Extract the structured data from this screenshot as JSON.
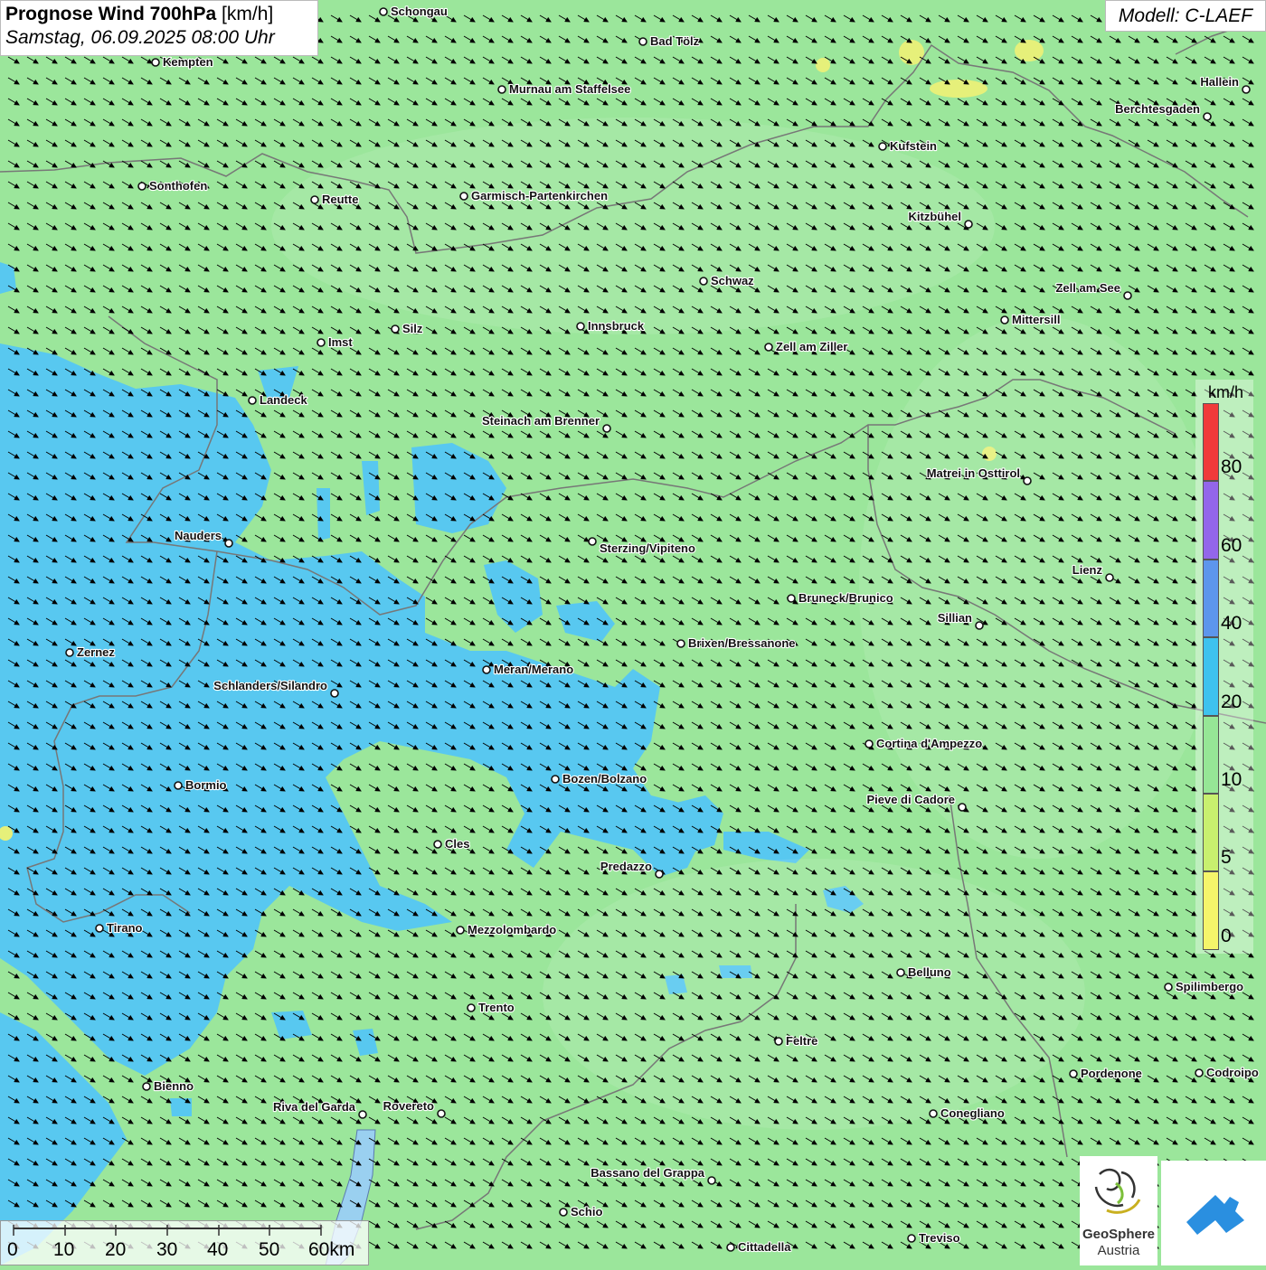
{
  "title": {
    "main": "Prognose Wind 700hPa",
    "unit": "[km/h]",
    "datetime": "Samstag, 06.09.2025 08:00 Uhr"
  },
  "model": "Modell: C-LAEF",
  "colors": {
    "background_10_20": "#9be69b",
    "field_20_40": "#58c8f0",
    "label_stroke": "#ffffff"
  },
  "legend": {
    "unit": "km/h",
    "bins": [
      {
        "from": 0,
        "to": 5,
        "color": "#f5f56a"
      },
      {
        "from": 5,
        "to": 10,
        "color": "#c8f06e"
      },
      {
        "from": 10,
        "to": 20,
        "color": "#96e696"
      },
      {
        "from": 20,
        "to": 40,
        "color": "#3ec2ee"
      },
      {
        "from": 40,
        "to": 60,
        "color": "#5d96ec"
      },
      {
        "from": 60,
        "to": 80,
        "color": "#9366ea"
      },
      {
        "from": 80,
        "to": 100,
        "color": "#f03a3a"
      }
    ],
    "labels": [
      "80",
      "60",
      "40",
      "20",
      "10",
      "5",
      "0"
    ]
  },
  "scalebar": {
    "labels": [
      "0",
      "10",
      "20",
      "30",
      "40",
      "50",
      "60km"
    ]
  },
  "wind": {
    "direction": "west-northwest flow (arrows pointing to east-southeast)"
  },
  "cities": [
    {
      "name": "Schongau"
    },
    {
      "name": "Bad Tölz"
    },
    {
      "name": "Kempten"
    },
    {
      "name": "Murnau am Staffelsee"
    },
    {
      "name": "Hallein"
    },
    {
      "name": "Berchtesgaden"
    },
    {
      "name": "Kufstein"
    },
    {
      "name": "Sonthofen"
    },
    {
      "name": "Reutte"
    },
    {
      "name": "Garmisch-Partenkirchen"
    },
    {
      "name": "Kitzbühel"
    },
    {
      "name": "Schwaz"
    },
    {
      "name": "Zell am See"
    },
    {
      "name": "Mittersill"
    },
    {
      "name": "Innsbruck"
    },
    {
      "name": "Silz"
    },
    {
      "name": "Imst"
    },
    {
      "name": "Zell am Ziller"
    },
    {
      "name": "Landeck"
    },
    {
      "name": "Steinach am Brenner"
    },
    {
      "name": "Matrei in Osttirol"
    },
    {
      "name": "Nauders"
    },
    {
      "name": "Sterzing/Vipiteno"
    },
    {
      "name": "Lienz"
    },
    {
      "name": "Bruneck/Brunico"
    },
    {
      "name": "Sillian"
    },
    {
      "name": "Brixen/Bressanone"
    },
    {
      "name": "Zernez"
    },
    {
      "name": "Meran/Merano"
    },
    {
      "name": "Schlanders/Silandro"
    },
    {
      "name": "Cortina d'Ampezzo"
    },
    {
      "name": "Bozen/Bolzano"
    },
    {
      "name": "Bormio"
    },
    {
      "name": "Pieve di Cadore"
    },
    {
      "name": "Cles"
    },
    {
      "name": "Predazzo"
    },
    {
      "name": "Tirano"
    },
    {
      "name": "Mezzolombardo"
    },
    {
      "name": "Belluno"
    },
    {
      "name": "Spilimbergo"
    },
    {
      "name": "Trento"
    },
    {
      "name": "Feltre"
    },
    {
      "name": "Pordenone"
    },
    {
      "name": "Codroipo"
    },
    {
      "name": "Bienno"
    },
    {
      "name": "Riva del Garda"
    },
    {
      "name": "Rovereto"
    },
    {
      "name": "Conegliano"
    },
    {
      "name": "Bassano del Grappa"
    },
    {
      "name": "Schio"
    },
    {
      "name": "Treviso"
    },
    {
      "name": "Cittadella"
    }
  ],
  "logos": {
    "geosphere_line1": "GeoSphere",
    "geosphere_line2": "Austria"
  }
}
